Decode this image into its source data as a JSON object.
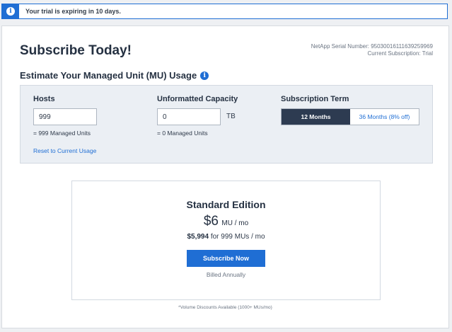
{
  "banner": {
    "icon": "info-icon",
    "text": "Your trial is expiring in 10 days."
  },
  "header": {
    "title": "Subscribe Today!",
    "serial_line": "NetApp Serial Number: 950300161116392599​69",
    "subscription_line": "Current Subscription: Trial"
  },
  "estimate": {
    "heading": "Estimate Your Managed Unit (MU) Usage",
    "heading_icon": "info-icon",
    "hosts": {
      "label": "Hosts",
      "value": "999",
      "note": "= 999 Managed Units",
      "reset": "Reset to Current Usage"
    },
    "capacity": {
      "label": "Unformatted Capacity",
      "value": "0",
      "unit": "TB",
      "note": "= 0 Managed Units"
    },
    "term": {
      "label": "Subscription Term",
      "options": [
        "12 Months",
        "36 Months (8% off)"
      ],
      "selected": "12 Months"
    }
  },
  "edition": {
    "name": "Standard Edition",
    "price": "$6",
    "price_unit": "MU / mo",
    "total_amount": "$5,994",
    "total_rest": "for 999 MUs / mo",
    "subscribe_label": "Subscribe Now",
    "billed": "Billed Annually"
  },
  "footnote": "*Volume Discounts Available (1000+ MUs/mo)",
  "colors": {
    "accent": "#1f6ed4",
    "active_term": "#2d3b51",
    "panel": "#ebeff4"
  }
}
